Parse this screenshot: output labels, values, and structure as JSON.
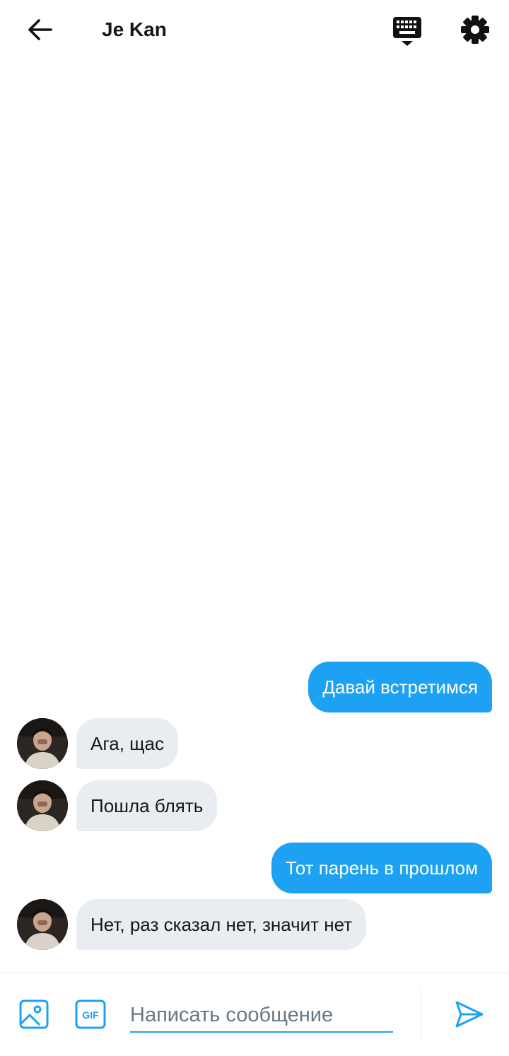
{
  "header": {
    "title": "Je Kan",
    "back_icon": "arrow-left-icon",
    "keyboard_icon": "keyboard-icon",
    "settings_icon": "gear-icon"
  },
  "messages": [
    {
      "direction": "out",
      "text": "Давай встретимся"
    },
    {
      "direction": "in",
      "text": "Ага, щас"
    },
    {
      "direction": "in",
      "text": "Пошла блять"
    },
    {
      "direction": "out",
      "text": "Тот парень в прошлом"
    },
    {
      "direction": "in",
      "text": "Нет, раз сказал нет, значит нет"
    }
  ],
  "composer": {
    "placeholder": "Написать сообщение",
    "value": "",
    "gif_label": "GIF",
    "image_icon": "image-icon",
    "send_icon": "send-icon"
  },
  "colors": {
    "accent": "#1da1f2",
    "incoming_bubble": "#e9ecf1",
    "text": "#14171a",
    "muted": "#657786"
  }
}
